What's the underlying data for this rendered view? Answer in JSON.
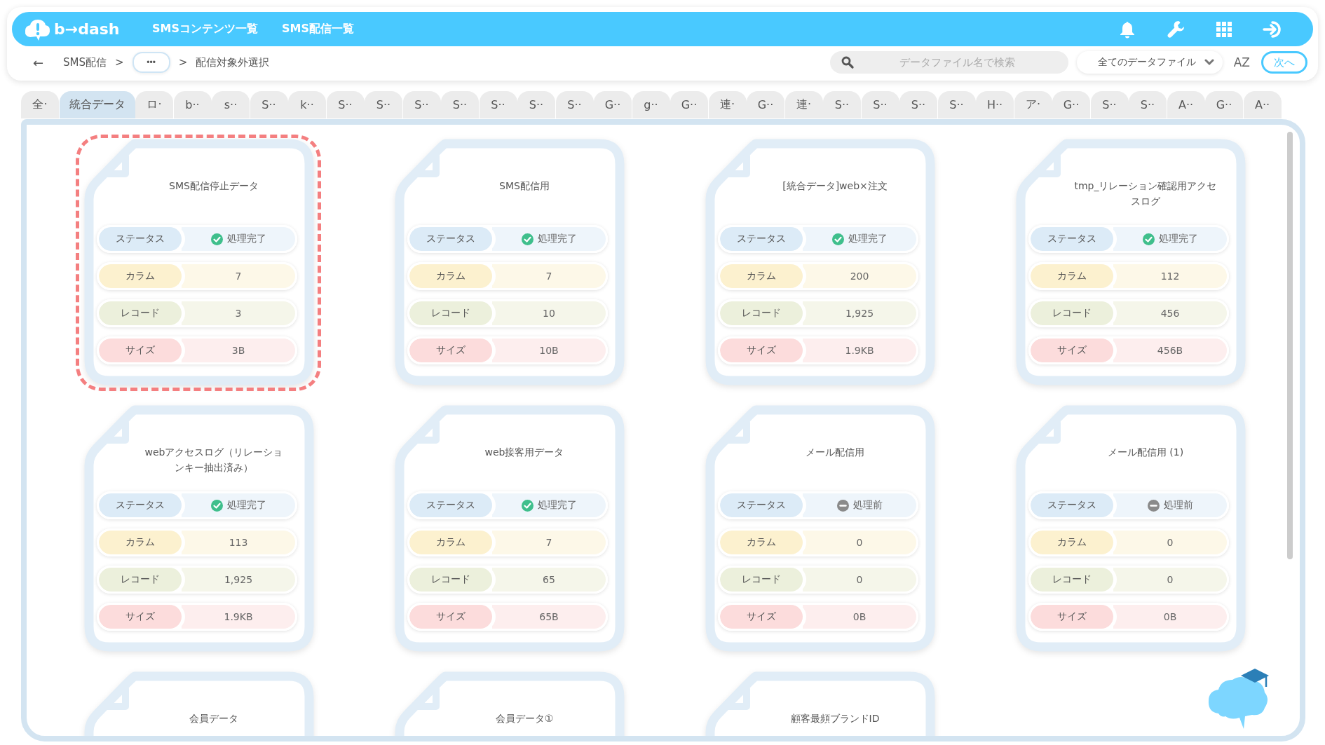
{
  "header": {
    "logo": "b→dash",
    "nav": [
      "SMSコンテンツ一覧",
      "SMS配信一覧"
    ]
  },
  "toolbar": {
    "back": "←",
    "breadcrumbs": [
      {
        "kind": "link",
        "text": "SMS配信"
      },
      {
        "kind": "sep",
        "text": ">"
      },
      {
        "kind": "more",
        "text": "•••"
      },
      {
        "kind": "sep",
        "text": ">"
      },
      {
        "kind": "current",
        "text": "配信対象外選択"
      }
    ],
    "search": {
      "placeholder": "データファイル名で検索"
    },
    "filter": "全てのデータファイル",
    "sort": "AZ",
    "next_button": "次へ"
  },
  "tabs": [
    {
      "label": "全·",
      "selected": false
    },
    {
      "label": "統合データ",
      "selected": true
    },
    {
      "label": "ロ·",
      "selected": false
    },
    {
      "label": "b··",
      "selected": false
    },
    {
      "label": "s··",
      "selected": false
    },
    {
      "label": "S··",
      "selected": false
    },
    {
      "label": "k··",
      "selected": false
    },
    {
      "label": "S··",
      "selected": false
    },
    {
      "label": "S··",
      "selected": false
    },
    {
      "label": "S··",
      "selected": false
    },
    {
      "label": "S··",
      "selected": false
    },
    {
      "label": "S··",
      "selected": false
    },
    {
      "label": "S··",
      "selected": false
    },
    {
      "label": "S··",
      "selected": false
    },
    {
      "label": "G··",
      "selected": false
    },
    {
      "label": "g··",
      "selected": false
    },
    {
      "label": "G··",
      "selected": false
    },
    {
      "label": "連·",
      "selected": false
    },
    {
      "label": "G··",
      "selected": false
    },
    {
      "label": "連·",
      "selected": false
    },
    {
      "label": "S··",
      "selected": false
    },
    {
      "label": "S··",
      "selected": false
    },
    {
      "label": "S··",
      "selected": false
    },
    {
      "label": "S··",
      "selected": false
    },
    {
      "label": "H··",
      "selected": false
    },
    {
      "label": "ア·",
      "selected": false
    },
    {
      "label": "G··",
      "selected": false
    },
    {
      "label": "S··",
      "selected": false
    },
    {
      "label": "S··",
      "selected": false
    },
    {
      "label": "A··",
      "selected": false
    },
    {
      "label": "G··",
      "selected": false
    },
    {
      "label": "A··",
      "selected": false
    }
  ],
  "cards": [
    {
      "title": "SMS配信停止データ",
      "selected": true,
      "status": {
        "label": "ステータス",
        "kind": "done",
        "text": "処理完了"
      },
      "fields": [
        {
          "kind": "columns",
          "label": "カラム",
          "value": "7"
        },
        {
          "kind": "records",
          "label": "レコード",
          "value": "3"
        },
        {
          "kind": "size",
          "label": "サイズ",
          "value": "3B"
        }
      ]
    },
    {
      "title": "SMS配信用",
      "selected": false,
      "status": {
        "label": "ステータス",
        "kind": "done",
        "text": "処理完了"
      },
      "fields": [
        {
          "kind": "columns",
          "label": "カラム",
          "value": "7"
        },
        {
          "kind": "records",
          "label": "レコード",
          "value": "10"
        },
        {
          "kind": "size",
          "label": "サイズ",
          "value": "10B"
        }
      ]
    },
    {
      "title": "[統合データ]web×注文",
      "selected": false,
      "status": {
        "label": "ステータス",
        "kind": "done",
        "text": "処理完了"
      },
      "fields": [
        {
          "kind": "columns",
          "label": "カラム",
          "value": "200"
        },
        {
          "kind": "records",
          "label": "レコード",
          "value": "1,925"
        },
        {
          "kind": "size",
          "label": "サイズ",
          "value": "1.9KB"
        }
      ]
    },
    {
      "title": "tmp_リレーション確認用アクセスログ",
      "selected": false,
      "status": {
        "label": "ステータス",
        "kind": "done",
        "text": "処理完了"
      },
      "fields": [
        {
          "kind": "columns",
          "label": "カラム",
          "value": "112"
        },
        {
          "kind": "records",
          "label": "レコード",
          "value": "456"
        },
        {
          "kind": "size",
          "label": "サイズ",
          "value": "456B"
        }
      ]
    },
    {
      "title": "webアクセスログ（リレーションキー抽出済み）",
      "selected": false,
      "status": {
        "label": "ステータス",
        "kind": "done",
        "text": "処理完了"
      },
      "fields": [
        {
          "kind": "columns",
          "label": "カラム",
          "value": "113"
        },
        {
          "kind": "records",
          "label": "レコード",
          "value": "1,925"
        },
        {
          "kind": "size",
          "label": "サイズ",
          "value": "1.9KB"
        }
      ]
    },
    {
      "title": "web接客用データ",
      "selected": false,
      "status": {
        "label": "ステータス",
        "kind": "done",
        "text": "処理完了"
      },
      "fields": [
        {
          "kind": "columns",
          "label": "カラム",
          "value": "7"
        },
        {
          "kind": "records",
          "label": "レコード",
          "value": "65"
        },
        {
          "kind": "size",
          "label": "サイズ",
          "value": "65B"
        }
      ]
    },
    {
      "title": "メール配信用",
      "selected": false,
      "status": {
        "label": "ステータス",
        "kind": "pending",
        "text": "処理前"
      },
      "fields": [
        {
          "kind": "columns",
          "label": "カラム",
          "value": "0"
        },
        {
          "kind": "records",
          "label": "レコード",
          "value": "0"
        },
        {
          "kind": "size",
          "label": "サイズ",
          "value": "0B"
        }
      ]
    },
    {
      "title": "メール配信用 (1)",
      "selected": false,
      "status": {
        "label": "ステータス",
        "kind": "pending",
        "text": "処理前"
      },
      "fields": [
        {
          "kind": "columns",
          "label": "カラム",
          "value": "0"
        },
        {
          "kind": "records",
          "label": "レコード",
          "value": "0"
        },
        {
          "kind": "size",
          "label": "サイズ",
          "value": "0B"
        }
      ]
    },
    {
      "title": "会員データ",
      "selected": false
    },
    {
      "title": "会員データ①",
      "selected": false
    },
    {
      "title": "顧客最頻ブランドID",
      "selected": false
    }
  ]
}
